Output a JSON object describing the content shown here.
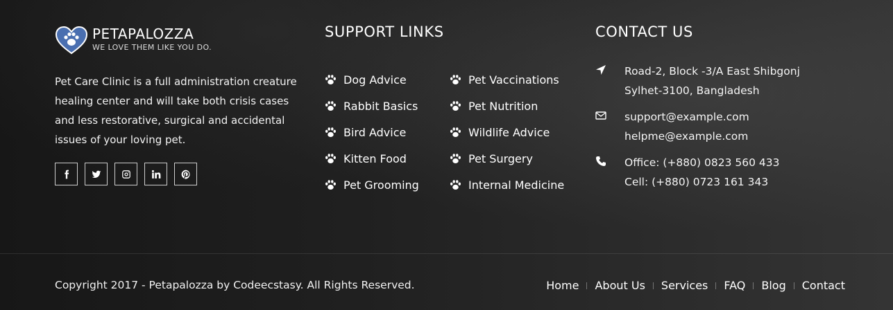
{
  "brand": {
    "name": "PETAPALOZZA",
    "tagline": "WE LOVE THEM LIKE YOU DO.",
    "logo_color": "#4a6fb0"
  },
  "about": {
    "text": "Pet Care Clinic is a full administration creature healing center and will take both crisis cases and less restorative, surgical and accidental issues of your loving pet."
  },
  "socials": [
    {
      "icon": "facebook-icon"
    },
    {
      "icon": "twitter-icon"
    },
    {
      "icon": "instagram-icon"
    },
    {
      "icon": "linkedin-icon"
    },
    {
      "icon": "pinterest-icon"
    }
  ],
  "support": {
    "heading": "SUPPORT LINKS",
    "col1": [
      "Dog Advice",
      "Rabbit Basics",
      "Bird Advice",
      "Kitten Food",
      "Pet Grooming"
    ],
    "col2": [
      "Pet Vaccinations",
      "Pet Nutrition",
      "Wildlife Advice",
      "Pet Surgery",
      "Internal Medicine"
    ]
  },
  "contact": {
    "heading": "CONTACT US",
    "address": [
      "Road-2, Block -3/A East Shibgonj",
      "Sylhet-3100, Bangladesh"
    ],
    "emails": [
      "support@example.com",
      "helpme@example.com"
    ],
    "phones": [
      "Office:  (+880) 0823 560 433",
      "Cell:  (+880) 0723 161 343"
    ]
  },
  "footer": {
    "copyright": "Copyright 2017 - Petapalozza by Codeecstasy. All Rights Reserved.",
    "nav": [
      "Home",
      "About Us",
      "Services",
      "FAQ",
      "Blog",
      "Contact"
    ]
  }
}
